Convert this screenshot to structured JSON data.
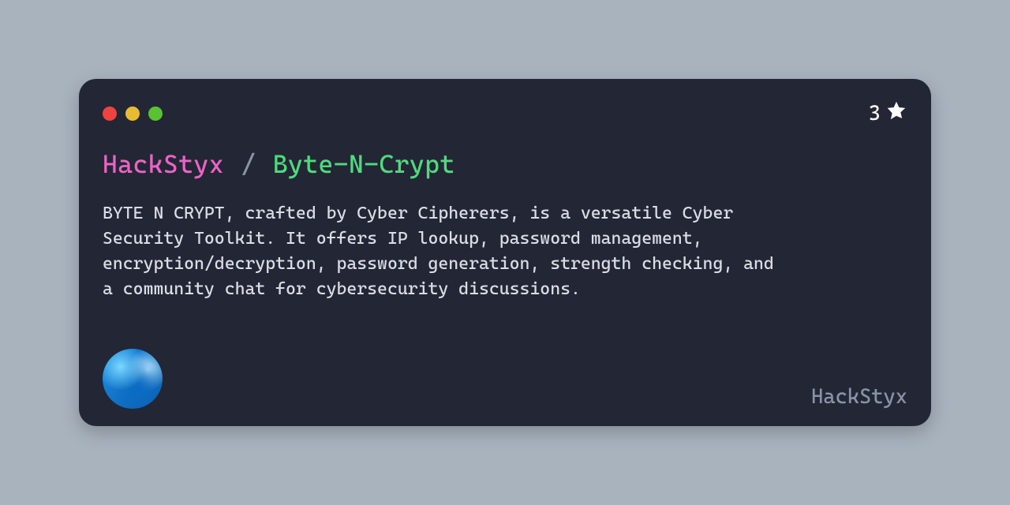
{
  "repo": {
    "owner": "HackStyx",
    "separator": "/",
    "name": "Byte-N-Crypt",
    "stars": "3",
    "description": " BYTE N CRYPT, crafted by Cyber Cipherers, is a versatile Cyber Security Toolkit. It offers IP lookup, password management, encryption/decryption, password generation, strength checking, and a community chat for cybersecurity discussions."
  },
  "footer": {
    "username": "HackStyx"
  },
  "colors": {
    "owner": "#E964C4",
    "reponame": "#4FDB7D",
    "bg": "#232635",
    "page": "#A9B3BE"
  }
}
